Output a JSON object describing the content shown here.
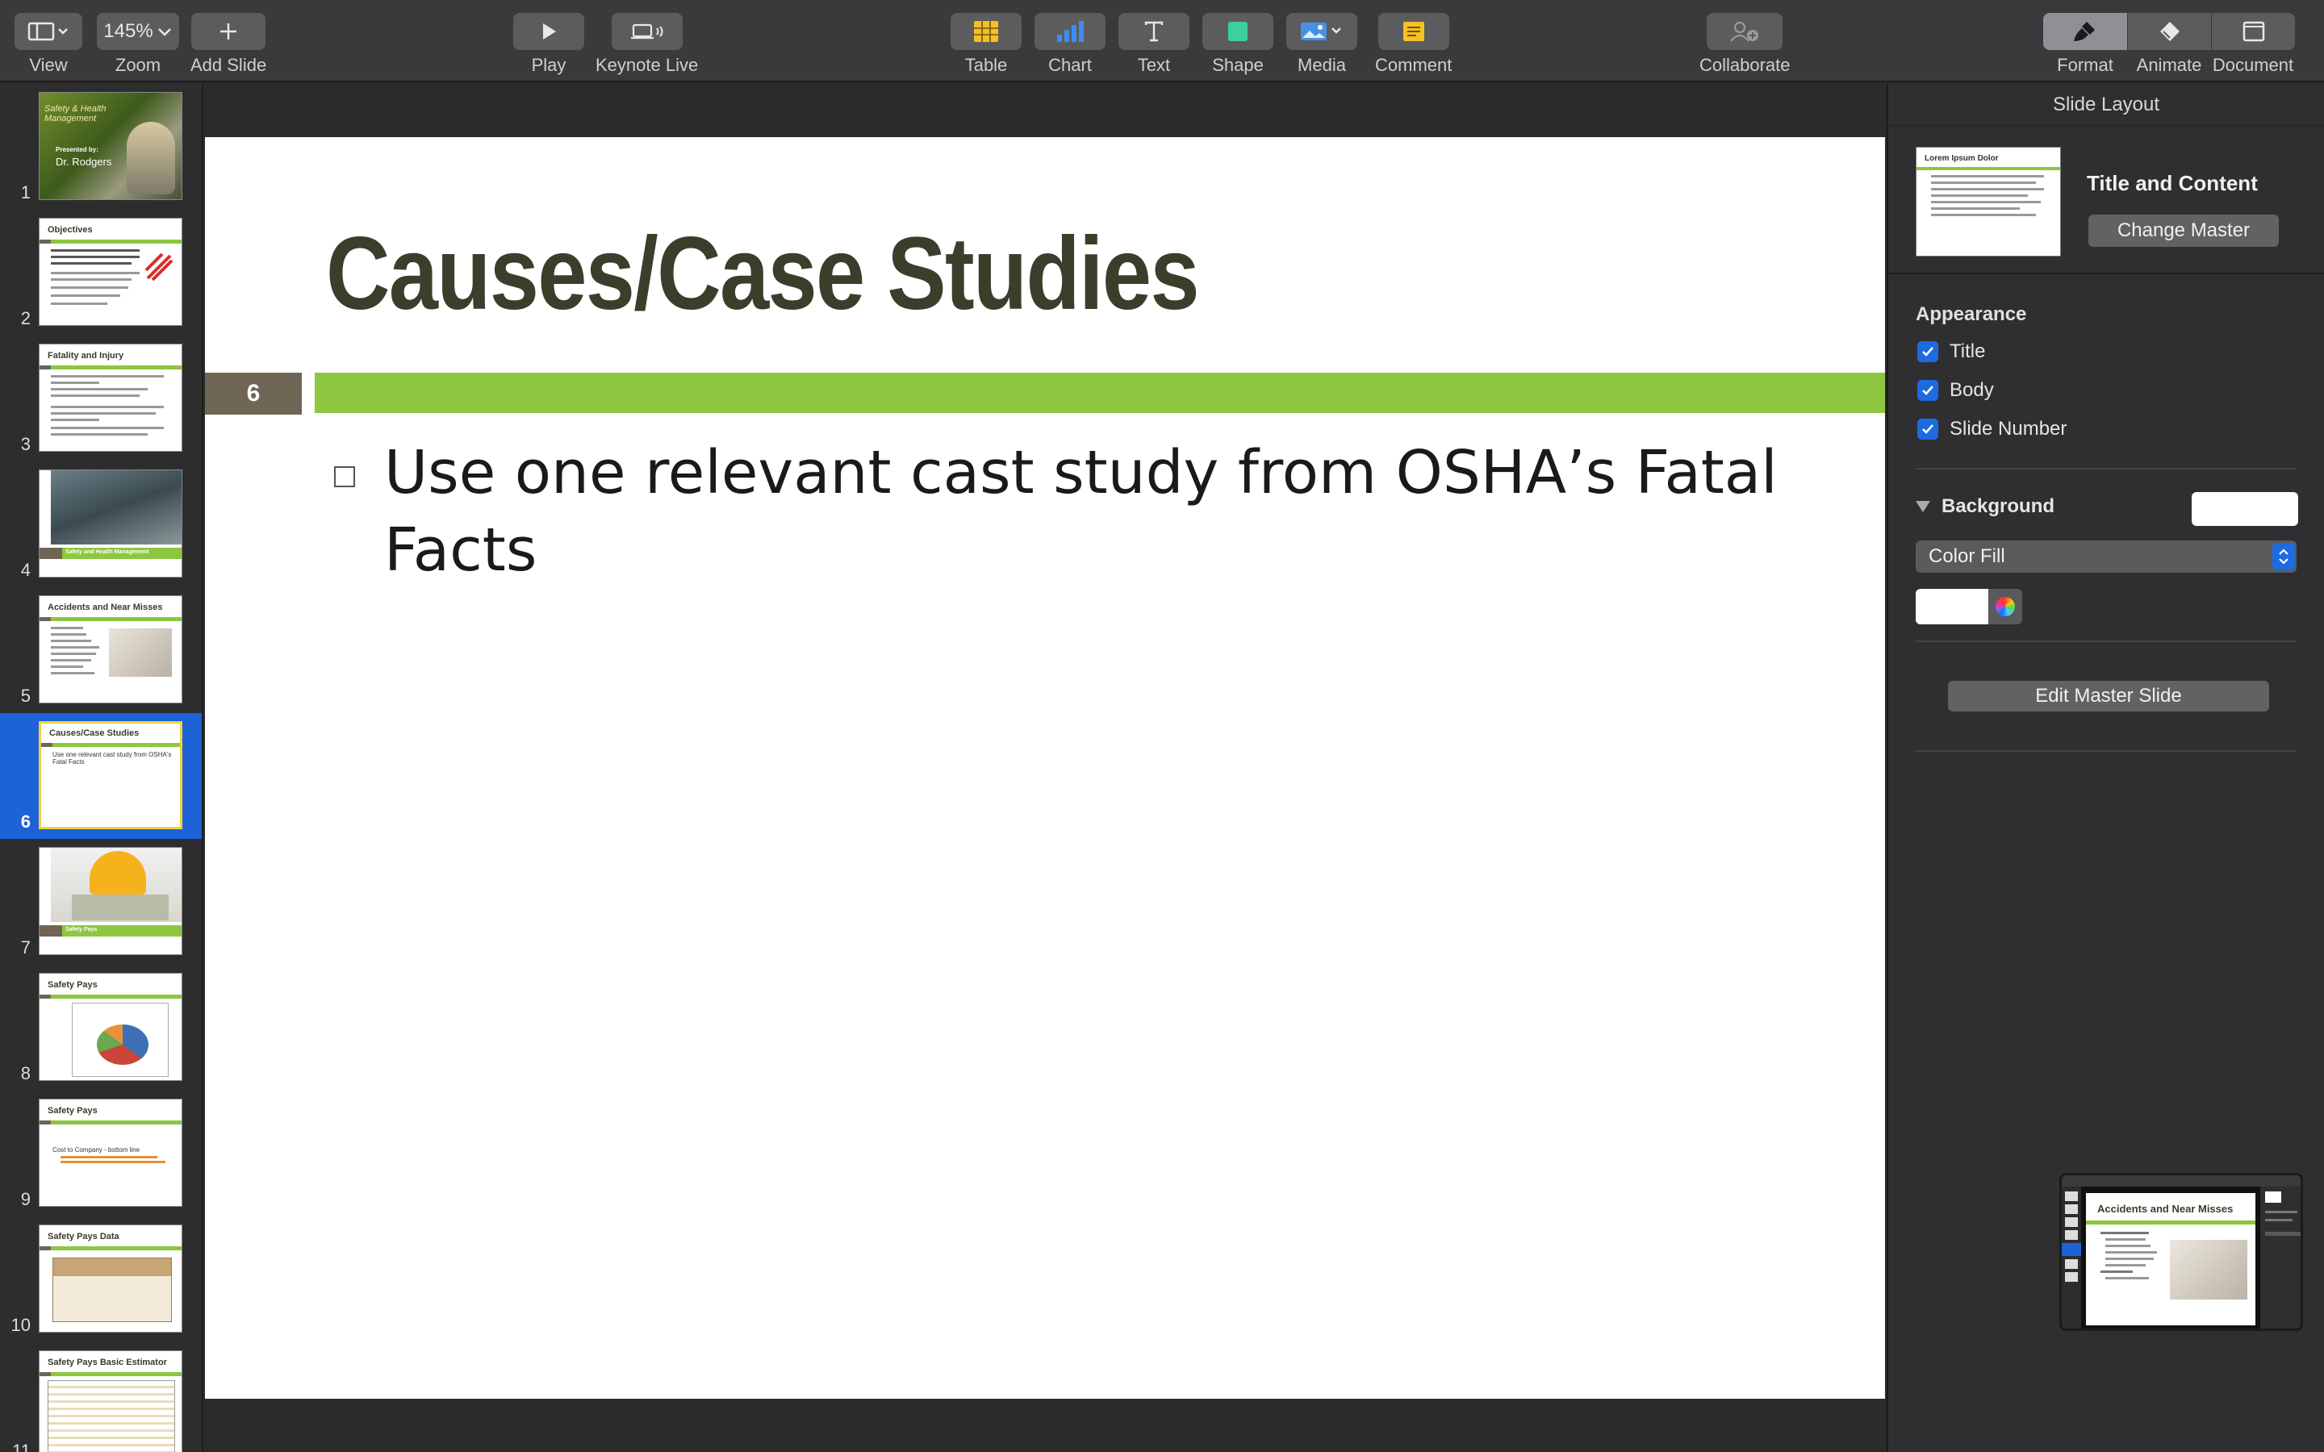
{
  "toolbar": {
    "view": "View",
    "zoom_value": "145%",
    "zoom": "Zoom",
    "add_slide": "Add Slide",
    "play": "Play",
    "keynote_live": "Keynote Live",
    "table": "Table",
    "chart": "Chart",
    "text": "Text",
    "shape": "Shape",
    "media": "Media",
    "comment": "Comment",
    "collaborate": "Collaborate",
    "format": "Format",
    "animate": "Animate",
    "document": "Document"
  },
  "navigator": {
    "selected_index": 6,
    "slides": [
      {
        "num": "1",
        "title": "Safety & Health Management",
        "lines": [
          "Presented by:",
          "Dr. Rodgers"
        ]
      },
      {
        "num": "2",
        "title": "Objectives",
        "lines": []
      },
      {
        "num": "3",
        "title": "Fatality and Injury",
        "lines": []
      },
      {
        "num": "4",
        "title": "Safety and Health Management",
        "lines": []
      },
      {
        "num": "5",
        "title": "Accidents and Near Misses",
        "lines": []
      },
      {
        "num": "6",
        "title": "Causes/Case Studies",
        "lines": [
          "Use one relevant cast study from OSHA's Fatal Facts"
        ]
      },
      {
        "num": "7",
        "title": "Safety Pays",
        "lines": []
      },
      {
        "num": "8",
        "title": "Safety Pays",
        "lines": []
      },
      {
        "num": "9",
        "title": "Safety Pays",
        "lines": [
          "Cost to Company - bottom line"
        ]
      },
      {
        "num": "10",
        "title": "Safety Pays Data",
        "lines": []
      },
      {
        "num": "11",
        "title": "Safety Pays Basic Estimator",
        "lines": []
      }
    ]
  },
  "slide": {
    "title": "Causes/Case Studies",
    "number": "6",
    "bullet": "Use one relevant cast study from OSHA’s Fatal Facts"
  },
  "inspector": {
    "header": "Slide Layout",
    "master_name": "Title and Content",
    "master_thumb_title": "Lorem Ipsum Dolor",
    "change_master": "Change Master",
    "appearance": "Appearance",
    "options": [
      {
        "label": "Title",
        "checked": true
      },
      {
        "label": "Body",
        "checked": true
      },
      {
        "label": "Slide Number",
        "checked": true
      }
    ],
    "background": "Background",
    "fill_type": "Color Fill",
    "edit_master": "Edit Master Slide"
  },
  "minimap": {
    "title": "Accidents and Near Misses"
  },
  "colors": {
    "accent_green": "#8dc63f",
    "number_box": "#6f6656",
    "selection_blue": "#1d62d6",
    "checkbox_blue": "#1d6be0"
  }
}
